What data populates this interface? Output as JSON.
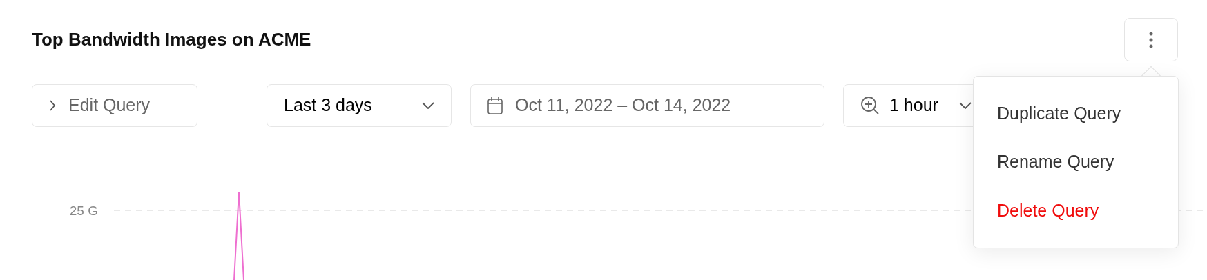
{
  "title": "Top Bandwidth Images on ACME",
  "more_button": {
    "expanded": true
  },
  "toolbar": {
    "edit_query": {
      "label": "Edit Query",
      "expanded": false
    },
    "range": {
      "value": "Last 3 days"
    },
    "dates": {
      "value": "Oct 11, 2022 – Oct 14, 2022"
    },
    "granularity": {
      "value": "1 hour"
    }
  },
  "menu": {
    "items": [
      {
        "label": "Duplicate Query",
        "kind": "normal"
      },
      {
        "label": "Rename Query",
        "kind": "normal"
      },
      {
        "label": "Delete Query",
        "kind": "danger"
      }
    ]
  },
  "chart": {
    "y_tick": "25 G"
  }
}
